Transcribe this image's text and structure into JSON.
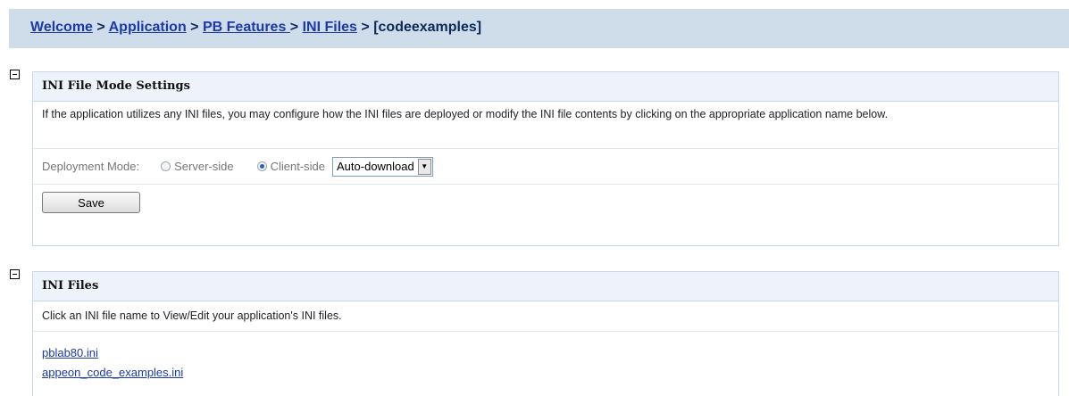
{
  "breadcrumb": {
    "items": [
      "Welcome",
      "Application",
      "PB Features ",
      "INI Files"
    ],
    "current": "[codeexamples]",
    "separator": ">"
  },
  "mode_panel": {
    "title": "INI File Mode Settings",
    "description": "If the application utilizes any INI files, you may configure how the INI files are deployed or modify the INI file contents by clicking on the appropriate application name below.",
    "deployment_label": "Deployment Mode:",
    "options": [
      {
        "label": "Server-side",
        "selected": false
      },
      {
        "label": "Client-side",
        "selected": true
      }
    ],
    "download_select": "Auto-download",
    "save_label": "Save"
  },
  "files_panel": {
    "title": "INI Files",
    "description": "Click an INI file name to View/Edit your application's INI files.",
    "files": [
      "pblab80.ini",
      "appeon_code_examples.ini"
    ]
  },
  "colors": {
    "breadcrumb_bg": "#cfdcea",
    "link": "#1b39a8",
    "panel_border": "#c8d8ea",
    "panel_header_bg": "#eef3fb"
  }
}
